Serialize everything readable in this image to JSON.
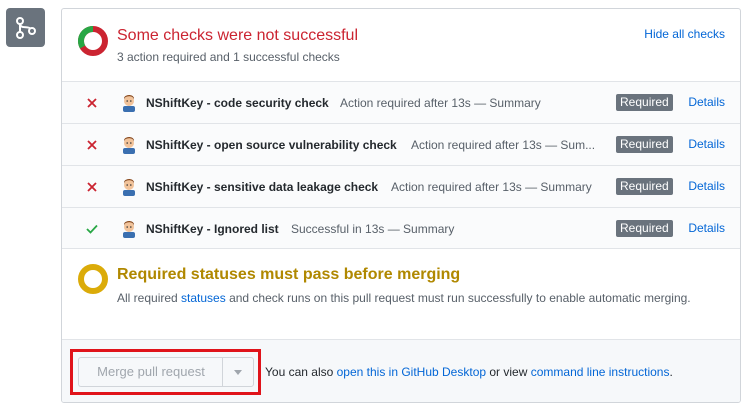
{
  "colors": {
    "fail": "#cb2431",
    "success": "#28a745",
    "pending": "#dbab09",
    "link": "#0366d6",
    "badge": "#6a737d"
  },
  "header": {
    "title": "Some checks were not successful",
    "subtitle": "3 action required and 1 successful checks",
    "hide_link": "Hide all checks",
    "summary_icon": "donut-status-icon"
  },
  "checks": [
    {
      "status": "fail",
      "status_icon": "x-icon",
      "name": "NShiftKey - code security check",
      "description": "Action required after 13s — Summary",
      "badge": "Required",
      "details": "Details"
    },
    {
      "status": "fail",
      "status_icon": "x-icon",
      "name": "NShiftKey - open source vulnerability check",
      "description": "Action required after 13s — Sum...",
      "badge": "Required",
      "details": "Details"
    },
    {
      "status": "fail",
      "status_icon": "x-icon",
      "name": "NShiftKey - sensitive data leakage check",
      "description": "Action required after 13s — Summary",
      "badge": "Required",
      "details": "Details"
    },
    {
      "status": "success",
      "status_icon": "check-icon",
      "name": "NShiftKey - Ignored list",
      "description": "Successful in 13s — Summary",
      "badge": "Required",
      "details": "Details"
    }
  ],
  "merge_status": {
    "title": "Required statuses must pass before merging",
    "body_before": "All required ",
    "body_link": "statuses",
    "body_after": " and check runs on this pull request must run successfully to enable automatic merging."
  },
  "merge": {
    "button_label": "Merge pull request",
    "note_prefix": "You can also ",
    "desktop_link": "open this in GitHub Desktop",
    "note_middle": " or view ",
    "cli_link": "command line instructions",
    "note_suffix": "."
  }
}
